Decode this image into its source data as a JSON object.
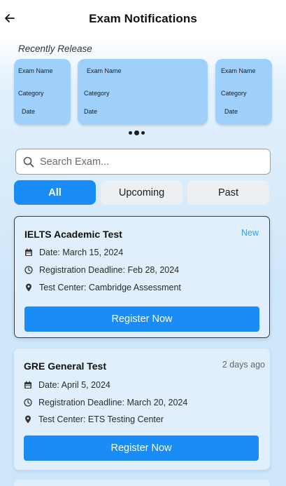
{
  "header": {
    "title": "Exam Notifications",
    "back_icon": "arrow-left-icon"
  },
  "recent": {
    "label": "Recently Release",
    "cards": [
      {
        "name": "Exam Name",
        "category": "Category",
        "date": "Date"
      },
      {
        "name": "Exam Name",
        "category": "Category",
        "date": "Date"
      },
      {
        "name": "Exam Name",
        "category": "Category",
        "date": "Date"
      }
    ],
    "active_dot": 1
  },
  "search": {
    "placeholder": "Search Exam...",
    "value": "",
    "icon": "search-icon"
  },
  "tabs": [
    {
      "label": "All",
      "active": true
    },
    {
      "label": "Upcoming",
      "active": false
    },
    {
      "label": "Past",
      "active": false
    }
  ],
  "exams": [
    {
      "title": "IELTS Academic Test",
      "badge": "New",
      "date": "Date: March 15, 2024",
      "deadline": "Registration Deadline: Feb 28, 2024",
      "center": "Test Center: Cambridge Assessment",
      "button": "Register Now"
    },
    {
      "title": "GRE General Test",
      "badge": "2 days ago",
      "date": "Date: April 5, 2024",
      "deadline": "Registration Deadline: March 20, 2024",
      "center": "Test Center: ETS Testing Center",
      "button": "Register Now"
    }
  ],
  "colors": {
    "accent": "#1a8cf5",
    "new_badge": "#3aa0f5",
    "card_bg": "#e0effb",
    "recent_card": "#9fd0fb"
  }
}
